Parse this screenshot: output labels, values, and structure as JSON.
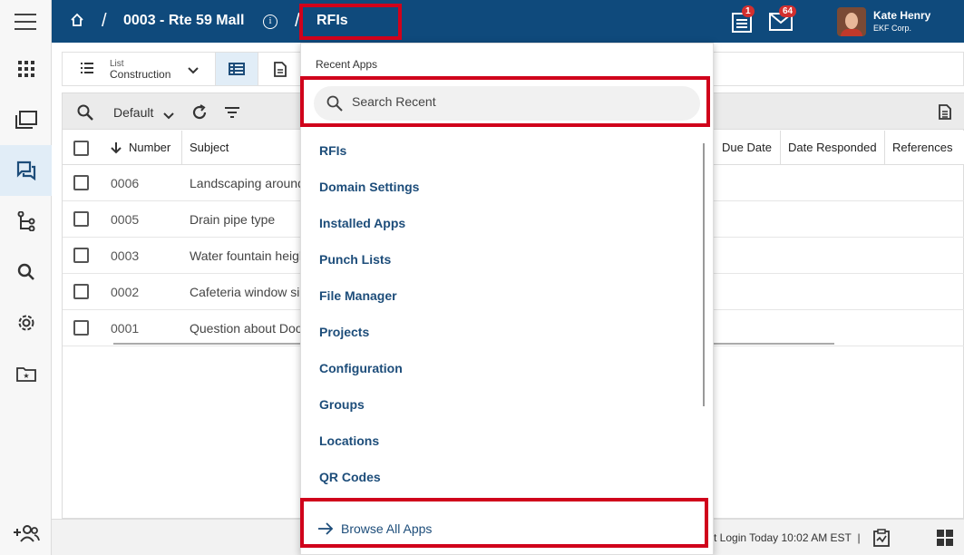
{
  "header": {
    "project": "0003 - Rte 59 Mall",
    "separator": "/",
    "app": "RFIs",
    "tasks_badge": "1",
    "mail_badge": "64",
    "user_name": "Kate Henry",
    "user_org": "EKF Corp."
  },
  "view": {
    "small_label": "List",
    "name": "Construction",
    "filter_name": "Default"
  },
  "table": {
    "columns": [
      "Number",
      "Subject",
      "Due Date",
      "Date Responded",
      "References"
    ],
    "rows": [
      {
        "number": "0006",
        "subject": "Landscaping around"
      },
      {
        "number": "0005",
        "subject": "Drain pipe type"
      },
      {
        "number": "0003",
        "subject": "Water fountain heigh"
      },
      {
        "number": "0002",
        "subject": "Cafeteria window si"
      },
      {
        "number": "0001",
        "subject": "Question about Doo"
      }
    ]
  },
  "status": {
    "last_login": "t Login Today 10:02 AM EST",
    "divider": "|"
  },
  "dropdown": {
    "title": "Recent Apps",
    "search_placeholder": "Search Recent",
    "items": [
      "RFIs",
      "Domain Settings",
      "Installed Apps",
      "Punch Lists",
      "File Manager",
      "Projects",
      "Configuration",
      "Groups",
      "Locations",
      "QR Codes"
    ],
    "browse_all": "Browse All Apps"
  },
  "colors": {
    "header_bg": "#0f4a7c",
    "link": "#1d4d7a",
    "highlight": "#d0021b",
    "active_rail": "#e1edf7"
  }
}
